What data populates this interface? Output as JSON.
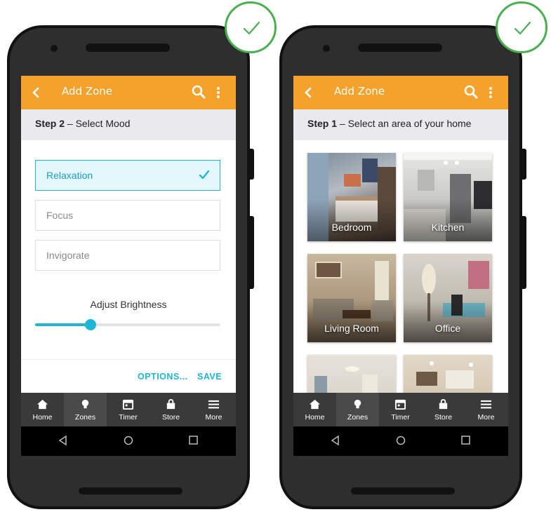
{
  "colors": {
    "accent": "#f4a22c",
    "highlight": "#1fb6d6",
    "check_badge": "#48b050",
    "nav_bg": "#3a3a3a"
  },
  "left_screen": {
    "appbar": {
      "title": "Add Zone"
    },
    "step": {
      "label": "Step 2",
      "text": " – Select Mood"
    },
    "moods": [
      {
        "label": "Relaxation",
        "selected": true
      },
      {
        "label": "Focus",
        "selected": false
      },
      {
        "label": "Invigorate",
        "selected": false
      }
    ],
    "brightness": {
      "label": "Adjust Brightness",
      "level_percent": 30
    },
    "actions": {
      "options_label": "OPTIONS...",
      "save_label": "SAVE"
    }
  },
  "right_screen": {
    "appbar": {
      "title": "Add Zone"
    },
    "step": {
      "label": "Step 1",
      "text": " – Select an area of your home"
    },
    "areas": [
      {
        "label": "Bedroom"
      },
      {
        "label": "Kitchen"
      },
      {
        "label": "Living Room"
      },
      {
        "label": "Office"
      },
      {
        "label": ""
      },
      {
        "label": ""
      }
    ]
  },
  "bottom_nav": [
    {
      "label": "Home",
      "icon": "home-icon"
    },
    {
      "label": "Zones",
      "icon": "bulb-icon",
      "active": true
    },
    {
      "label": "Timer",
      "icon": "calendar-icon"
    },
    {
      "label": "Store",
      "icon": "bag-icon"
    },
    {
      "label": "More",
      "icon": "hamburger-icon"
    }
  ]
}
